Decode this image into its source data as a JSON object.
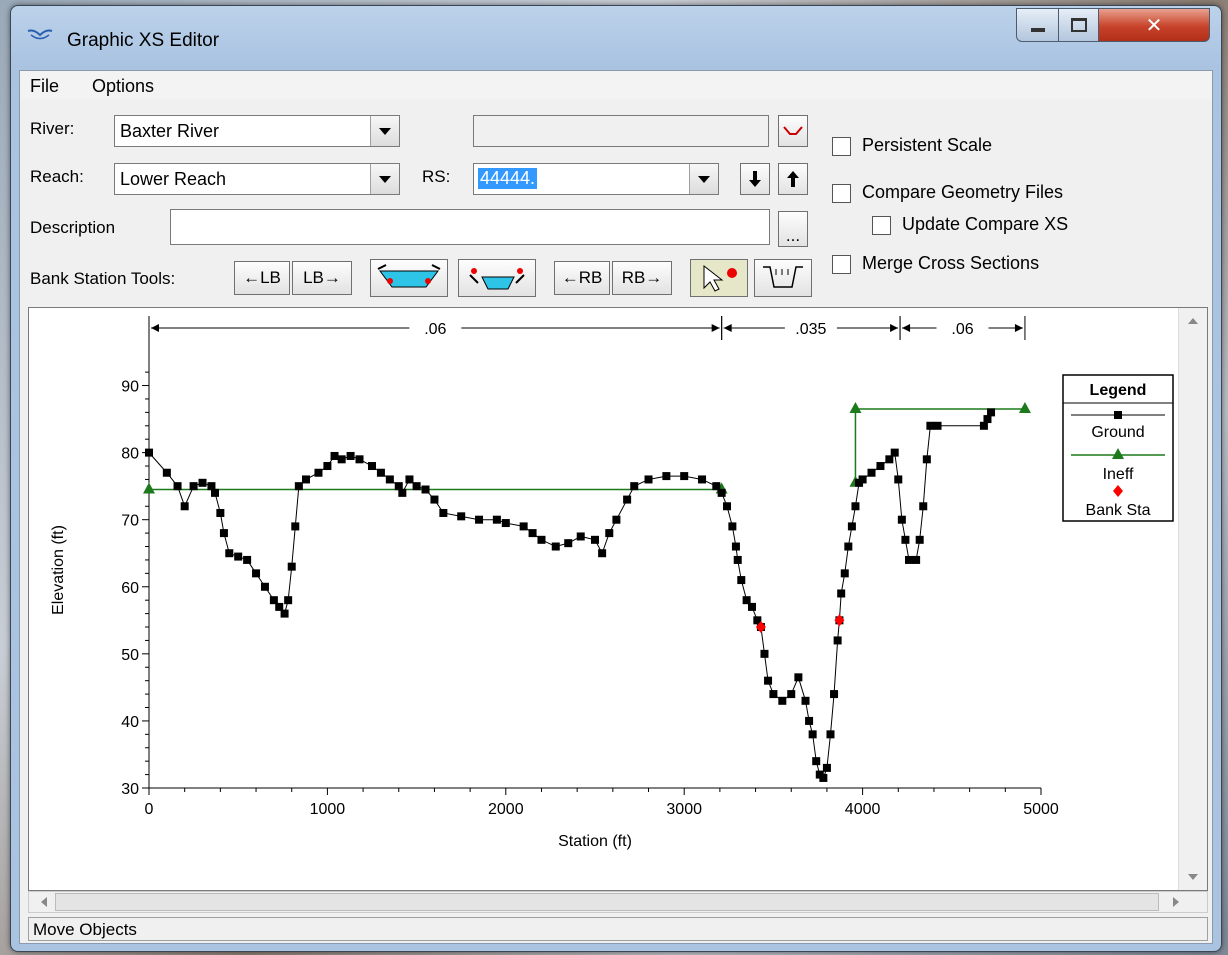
{
  "window": {
    "title": "Graphic XS Editor"
  },
  "menu": {
    "file": "File",
    "options": "Options"
  },
  "controls": {
    "river_label": "River:",
    "river_value": "Baxter River",
    "reach_label": "Reach:",
    "reach_value": "Lower Reach",
    "rs_label": "RS:",
    "rs_value": "44444.",
    "description_label": "Description",
    "description_value": "",
    "ellipsis": "...",
    "bank_tools_label": "Bank Station Tools:",
    "left_lb": "←LB",
    "lb_right": "LB→",
    "left_rb": "←RB",
    "rb_right": "RB→"
  },
  "options": {
    "persistent_scale": {
      "label": "Persistent Scale",
      "checked": false
    },
    "compare_geometry": {
      "label": "Compare Geometry Files",
      "checked": false
    },
    "update_compare": {
      "label": "Update Compare XS",
      "checked": false
    },
    "merge_sections": {
      "label": "Merge Cross Sections",
      "checked": false
    }
  },
  "status": {
    "text": "Move Objects"
  },
  "colors": {
    "ground": "#000000",
    "ineff": "#1c7a1c",
    "bank": "#ff0000",
    "rs_highlight": "#3399ff"
  },
  "chart_data": {
    "type": "line",
    "xlabel": "Station (ft)",
    "ylabel": "Elevation (ft)",
    "xlim": [
      0,
      5000
    ],
    "ylim": [
      30,
      95
    ],
    "xticks": [
      0,
      1000,
      2000,
      3000,
      4000,
      5000
    ],
    "yticks": [
      30,
      40,
      50,
      60,
      70,
      80,
      90
    ],
    "legend": {
      "title": "Legend",
      "position": "right",
      "entries": [
        "Ground",
        "Ineff",
        "Bank Sta"
      ]
    },
    "manning": [
      {
        "from": 0,
        "to": 3210,
        "label": ".06"
      },
      {
        "from": 3210,
        "to": 4210,
        "label": ".035"
      },
      {
        "from": 4210,
        "to": 4910,
        "label": ".06"
      }
    ],
    "ground": [
      [
        0,
        80
      ],
      [
        100,
        77
      ],
      [
        160,
        75
      ],
      [
        200,
        72
      ],
      [
        250,
        75
      ],
      [
        300,
        75.5
      ],
      [
        350,
        75
      ],
      [
        370,
        74
      ],
      [
        400,
        71
      ],
      [
        420,
        68
      ],
      [
        450,
        65
      ],
      [
        500,
        64.5
      ],
      [
        550,
        64
      ],
      [
        600,
        62
      ],
      [
        650,
        60
      ],
      [
        700,
        58
      ],
      [
        730,
        57
      ],
      [
        760,
        56
      ],
      [
        780,
        58
      ],
      [
        800,
        63
      ],
      [
        820,
        69
      ],
      [
        840,
        75
      ],
      [
        880,
        76
      ],
      [
        950,
        77
      ],
      [
        1000,
        78
      ],
      [
        1040,
        79.5
      ],
      [
        1080,
        79
      ],
      [
        1130,
        79.5
      ],
      [
        1180,
        79
      ],
      [
        1250,
        78
      ],
      [
        1300,
        77
      ],
      [
        1350,
        76
      ],
      [
        1400,
        75
      ],
      [
        1420,
        74
      ],
      [
        1460,
        76
      ],
      [
        1500,
        75
      ],
      [
        1550,
        74.5
      ],
      [
        1600,
        73
      ],
      [
        1650,
        71
      ],
      [
        1750,
        70.5
      ],
      [
        1850,
        70
      ],
      [
        1950,
        70
      ],
      [
        2000,
        69.5
      ],
      [
        2100,
        69
      ],
      [
        2150,
        68
      ],
      [
        2200,
        67
      ],
      [
        2280,
        66
      ],
      [
        2350,
        66.5
      ],
      [
        2420,
        67.5
      ],
      [
        2500,
        67
      ],
      [
        2540,
        65
      ],
      [
        2580,
        68
      ],
      [
        2620,
        70
      ],
      [
        2680,
        73
      ],
      [
        2720,
        75
      ],
      [
        2800,
        76
      ],
      [
        2900,
        76.5
      ],
      [
        3000,
        76.5
      ],
      [
        3100,
        76
      ],
      [
        3180,
        75
      ],
      [
        3210,
        74
      ],
      [
        3240,
        72
      ],
      [
        3270,
        69
      ],
      [
        3290,
        66
      ],
      [
        3300,
        64
      ],
      [
        3320,
        61
      ],
      [
        3350,
        58
      ],
      [
        3380,
        57
      ],
      [
        3410,
        55
      ],
      [
        3430,
        54
      ],
      [
        3450,
        50
      ],
      [
        3470,
        46
      ],
      [
        3500,
        44
      ],
      [
        3550,
        43
      ],
      [
        3600,
        44
      ],
      [
        3640,
        46.5
      ],
      [
        3680,
        43
      ],
      [
        3700,
        40
      ],
      [
        3720,
        38
      ],
      [
        3740,
        34
      ],
      [
        3760,
        32
      ],
      [
        3780,
        31.5
      ],
      [
        3800,
        33
      ],
      [
        3820,
        38
      ],
      [
        3840,
        44
      ],
      [
        3860,
        52
      ],
      [
        3870,
        55
      ],
      [
        3880,
        59
      ],
      [
        3900,
        62
      ],
      [
        3920,
        66
      ],
      [
        3940,
        69
      ],
      [
        3960,
        72
      ],
      [
        3980,
        75.5
      ],
      [
        4000,
        76
      ],
      [
        4050,
        77
      ],
      [
        4100,
        78
      ],
      [
        4150,
        79
      ],
      [
        4180,
        80
      ],
      [
        4200,
        76
      ],
      [
        4220,
        70
      ],
      [
        4240,
        67
      ],
      [
        4260,
        64
      ],
      [
        4300,
        64
      ],
      [
        4320,
        67
      ],
      [
        4340,
        72
      ],
      [
        4360,
        79
      ],
      [
        4380,
        84
      ],
      [
        4420,
        84
      ],
      [
        4680,
        84
      ],
      [
        4700,
        85
      ],
      [
        4720,
        86
      ]
    ],
    "ineff": [
      {
        "points": [
          [
            0,
            74.5
          ],
          [
            3210,
            74.5
          ]
        ],
        "markers": [
          [
            0,
            74.5
          ],
          [
            3210,
            74.5
          ]
        ]
      },
      {
        "points": [
          [
            3960,
            75.5
          ],
          [
            3960,
            86.5
          ],
          [
            4910,
            86.5
          ]
        ],
        "markers": [
          [
            3960,
            75.5
          ],
          [
            3960,
            86.5
          ],
          [
            4910,
            86.5
          ]
        ]
      }
    ],
    "bank": [
      [
        3430,
        54
      ],
      [
        3870,
        55
      ]
    ]
  }
}
